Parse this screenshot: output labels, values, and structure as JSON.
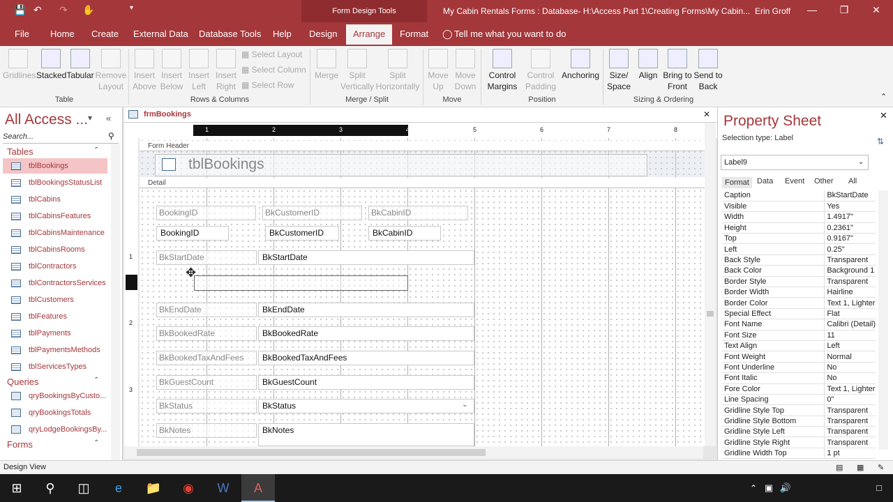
{
  "titlebar": {
    "context_tab": "Form Design Tools",
    "document_title": "My Cabin Rentals Forms : Database- H:\\Access Part 1\\Creating Forms\\My Cabin...",
    "user": "Erin Groff"
  },
  "menu": [
    "File",
    "Home",
    "Create",
    "External Data",
    "Database Tools",
    "Help",
    "Design",
    "Arrange",
    "Format"
  ],
  "tell_me": "Tell me what you want to do",
  "ribbon": {
    "table_group": {
      "label": "Table",
      "items": [
        "Gridlines",
        "Stacked",
        "Tabular",
        "Remove Layout"
      ]
    },
    "rows_columns_group": {
      "label": "Rows & Columns",
      "items": [
        "Insert Above",
        "Insert Below",
        "Insert Left",
        "Insert Right"
      ],
      "small": [
        "Select Layout",
        "Select Column",
        "Select Row"
      ]
    },
    "merge_split_group": {
      "label": "Merge / Split",
      "items": [
        "Merge",
        "Split Vertically",
        "Split Horizontally"
      ]
    },
    "move_group": {
      "label": "Move",
      "items": [
        "Move Up",
        "Move Down"
      ]
    },
    "position_group": {
      "label": "Position",
      "items": [
        "Control Margins",
        "Control Padding",
        "Anchoring"
      ]
    },
    "sizing_group": {
      "label": "Sizing & Ordering",
      "items": [
        "Size/ Space",
        "Align",
        "Bring to Front",
        "Send to Back"
      ]
    }
  },
  "nav": {
    "title": "All Access ...",
    "search_placeholder": "Search...",
    "tables_label": "Tables",
    "tables": [
      "tblBookings",
      "tblBookingsStatusList",
      "tblCabins",
      "tblCabinsFeatures",
      "tblCabinsMaintenance",
      "tblCabinsRooms",
      "tblContractors",
      "tblContractorsServices",
      "tblCustomers",
      "tblFeatures",
      "tblPayments",
      "tblPaymentsMethods",
      "tblServicesTypes"
    ],
    "queries_label": "Queries",
    "queries": [
      "qryBookingsByCusto...",
      "qryBookingsTotals",
      "qryLodgeBookingsBy..."
    ],
    "forms_label": "Forms"
  },
  "document": {
    "tab": "frmBookings",
    "form_header_label": "Form Header",
    "form_title": "tblBookings",
    "detail_label": "Detail",
    "ruler_numbers": [
      "1",
      "2",
      "3",
      "4",
      "5",
      "6",
      "7",
      "8"
    ],
    "vruler_numbers": [
      "1",
      "2",
      "3"
    ],
    "top_labels": [
      "BookingID",
      "BkCustomerID",
      "BkCabinID"
    ],
    "top_textboxes": [
      "BookingID",
      "BkCustomerID",
      "BkCabinID"
    ],
    "fields": [
      {
        "label": "BkStartDate",
        "box": "BkStartDate"
      },
      {
        "label": "BkEndDate",
        "box": "BkEndDate"
      },
      {
        "label": "BkBookedRate",
        "box": "BkBookedRate"
      },
      {
        "label": "BkBookedTaxAndFees",
        "box": "BkBookedTaxAndFees"
      },
      {
        "label": "BkGuestCount",
        "box": "BkGuestCount"
      },
      {
        "label": "BkStatus",
        "box": "BkStatus"
      },
      {
        "label": "BkNotes",
        "box": "BkNotes"
      }
    ]
  },
  "property_sheet": {
    "title": "Property Sheet",
    "selection_type": "Selection type: Label",
    "selected_control": "Label9",
    "tabs": [
      "Format",
      "Data",
      "Event",
      "Other",
      "All"
    ],
    "properties": [
      [
        "Caption",
        "BkStartDate"
      ],
      [
        "Visible",
        "Yes"
      ],
      [
        "Width",
        "1.4917\""
      ],
      [
        "Height",
        "0.2361\""
      ],
      [
        "Top",
        "0.9167\""
      ],
      [
        "Left",
        "0.25\""
      ],
      [
        "Back Style",
        "Transparent"
      ],
      [
        "Back Color",
        "Background 1"
      ],
      [
        "Border Style",
        "Transparent"
      ],
      [
        "Border Width",
        "Hairline"
      ],
      [
        "Border Color",
        "Text 1, Lighter"
      ],
      [
        "Special Effect",
        "Flat"
      ],
      [
        "Font Name",
        "Calibri (Detail)"
      ],
      [
        "Font Size",
        "11"
      ],
      [
        "Text Align",
        "Left"
      ],
      [
        "Font Weight",
        "Normal"
      ],
      [
        "Font Underline",
        "No"
      ],
      [
        "Font Italic",
        "No"
      ],
      [
        "Fore Color",
        "Text 1, Lighter"
      ],
      [
        "Line Spacing",
        "0\""
      ],
      [
        "Gridline Style Top",
        "Transparent"
      ],
      [
        "Gridline Style Bottom",
        "Transparent"
      ],
      [
        "Gridline Style Left",
        "Transparent"
      ],
      [
        "Gridline Style Right",
        "Transparent"
      ],
      [
        "Gridline Width Top",
        "1 pt"
      ]
    ]
  },
  "status": "Design View",
  "colors": {
    "accent": "#a4373a",
    "selected_nav": "#f5c4c6"
  }
}
